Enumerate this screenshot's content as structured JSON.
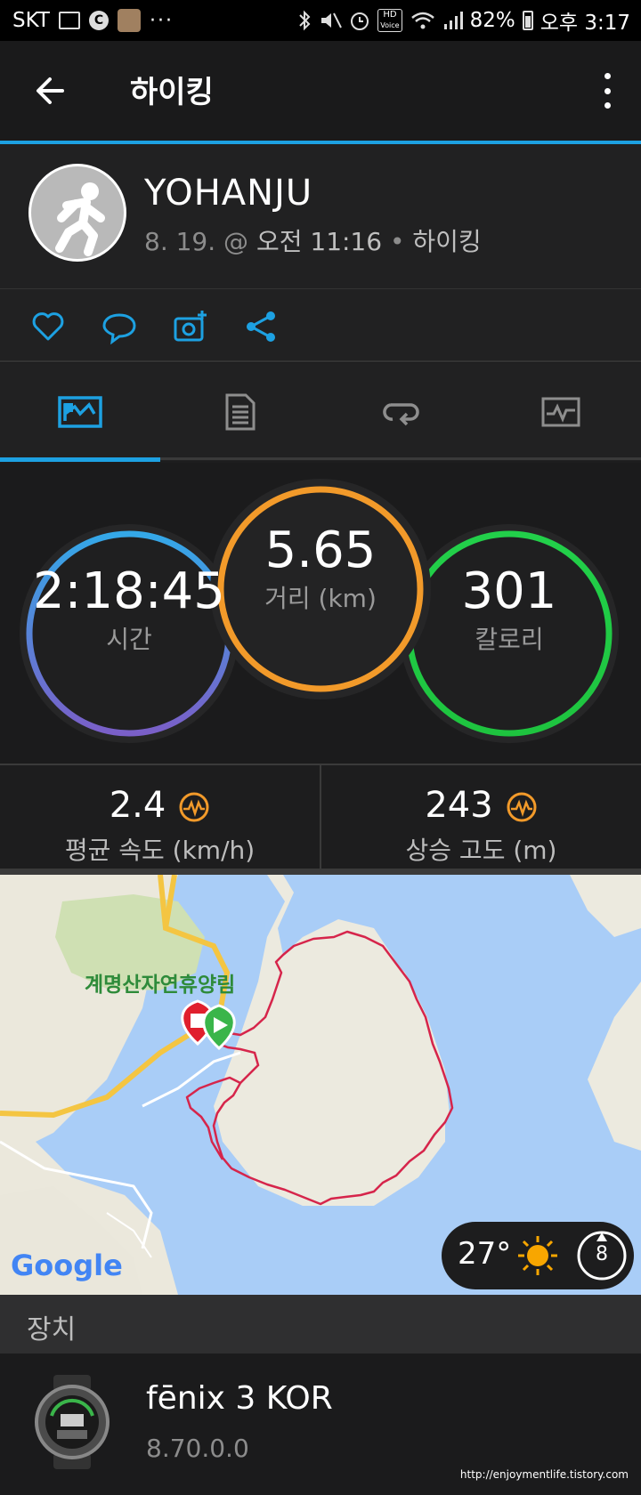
{
  "status_bar": {
    "carrier": "SKT",
    "battery": "82%",
    "time": "오후 3:17",
    "hd_label": "HD",
    "voice_label": "Voice",
    "dots": "···",
    "gear_letter": "C",
    "icons": [
      "image-icon",
      "settings-app-icon",
      "app-icon",
      "more-dots-icon",
      "bluetooth-icon",
      "mute-icon",
      "alarm-icon",
      "hd-voice-icon",
      "wifi-icon",
      "signal-icon",
      "battery-icon"
    ]
  },
  "app_bar": {
    "title": "하이킹",
    "back_icon": "arrow-left-icon",
    "menu_icon": "more-vert-icon"
  },
  "profile": {
    "name": "YOHANJU",
    "date": "8. 19. @ ",
    "time": "오전 11:16",
    "separator": " • ",
    "activity": "하이킹"
  },
  "actions": [
    "heart-icon",
    "comment-icon",
    "add-photo-icon",
    "share-icon"
  ],
  "tabs": [
    {
      "icon": "overview-icon",
      "active": true
    },
    {
      "icon": "details-icon",
      "active": false
    },
    {
      "icon": "laps-icon",
      "active": false
    },
    {
      "icon": "chart-icon",
      "active": false
    }
  ],
  "stats": {
    "time": {
      "value": "2:18:45",
      "label": "시간"
    },
    "distance": {
      "value": "5.65",
      "label": "거리 (km)"
    },
    "calories": {
      "value": "301",
      "label": "칼로리"
    }
  },
  "metrics": [
    {
      "value": "2.4",
      "label": "평균 속도 (km/h)",
      "icon": "pulse-icon"
    },
    {
      "value": "243",
      "label": "상승 고도 (m)",
      "icon": "pulse-icon"
    }
  ],
  "map": {
    "place_label": "계명산자연휴양림",
    "provider": "Google",
    "temperature": "27°",
    "wind": "8",
    "colors": {
      "route": "#d6254b",
      "water": "#a9cdf7",
      "land": "#eceadf",
      "road": "#f4c542"
    }
  },
  "device": {
    "section_title": "장치",
    "name": "fēnix 3 KOR",
    "version": "8.70.0.0"
  },
  "watermark": "http://enjoymentlife.tistory.com"
}
